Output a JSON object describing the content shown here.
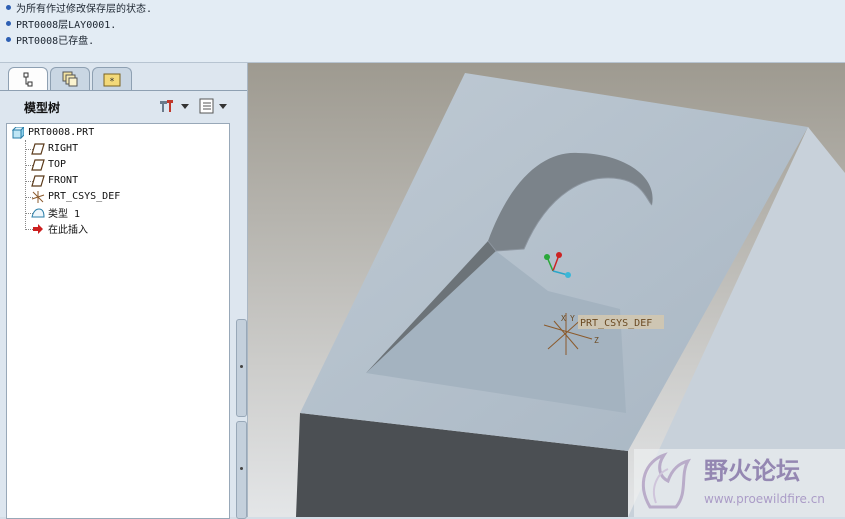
{
  "messages": [
    "为所有作过修改保存层的状态.",
    "PRT0008层LAY0001.",
    "PRT0008已存盘."
  ],
  "left_panel": {
    "tabs": [
      "model-tree",
      "layers",
      "favorites"
    ],
    "title": "模型树",
    "tree": [
      {
        "label": "PRT0008.PRT",
        "icon": "part-icon"
      },
      {
        "label": "RIGHT",
        "icon": "datum-plane-icon"
      },
      {
        "label": "TOP",
        "icon": "datum-plane-icon"
      },
      {
        "label": "FRONT",
        "icon": "datum-plane-icon"
      },
      {
        "label": "PRT_CSYS_DEF",
        "icon": "csys-icon"
      },
      {
        "label": "类型  1",
        "icon": "surface-icon"
      },
      {
        "label": "在此插入",
        "icon": "insert-here-arrow-icon"
      }
    ]
  },
  "viewport": {
    "csys_label": "PRT_CSYS_DEF",
    "axis_x": "X",
    "axis_y": "Y",
    "axis_z": "Z"
  },
  "watermark": {
    "title": "野火论坛",
    "url": "www.proewildfire.cn"
  },
  "colors": {
    "background_gradient_top": "#9e9a90",
    "part_top": "#b6c3cf",
    "part_side": "#cdd7e1",
    "part_front": "#4d5154",
    "accent_blue": "#2d5fb3"
  }
}
